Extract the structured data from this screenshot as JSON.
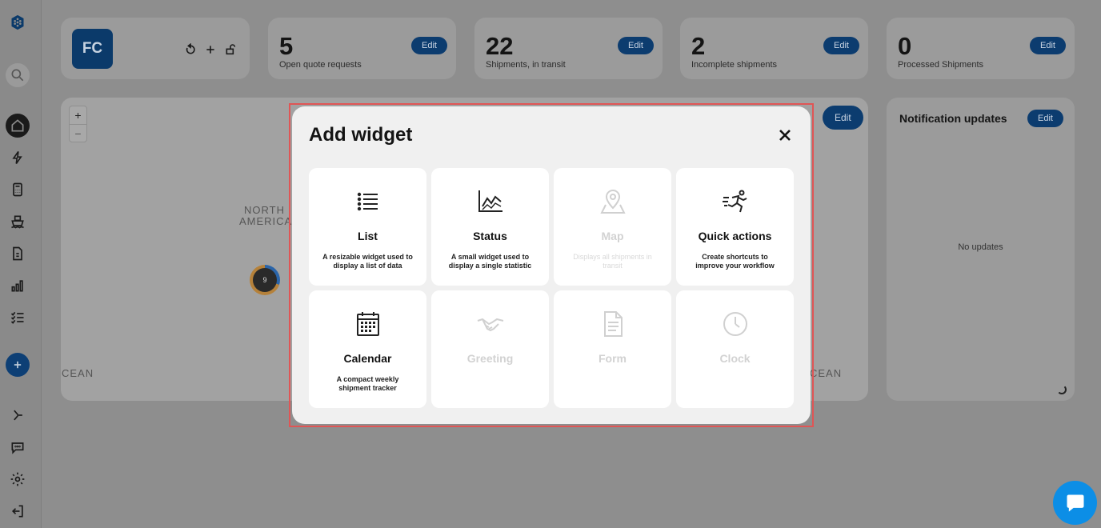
{
  "header": {
    "avatar_initials": "FC"
  },
  "stats": [
    {
      "value": "5",
      "label": "Open quote requests",
      "edit": "Edit"
    },
    {
      "value": "22",
      "label": "Shipments, in transit",
      "edit": "Edit"
    },
    {
      "value": "2",
      "label": "Incomplete shipments",
      "edit": "Edit"
    },
    {
      "value": "0",
      "label": "Processed Shipments",
      "edit": "Edit"
    }
  ],
  "map": {
    "edit": "Edit",
    "zoom_in": "+",
    "zoom_out": "−",
    "labels": [
      "NORTH",
      "AMERICA",
      "CEAN",
      "CEAN"
    ],
    "cluster_count": "9"
  },
  "notifications": {
    "title": "Notification updates",
    "edit": "Edit",
    "empty": "No updates"
  },
  "modal": {
    "title": "Add widget",
    "close_icon": "close-icon",
    "widgets": [
      {
        "title": "List",
        "desc": "A resizable widget used to display a list of data",
        "icon": "list-icon",
        "enabled": true
      },
      {
        "title": "Status",
        "desc": "A small widget used to display a single statistic",
        "icon": "chart-icon",
        "enabled": true
      },
      {
        "title": "Map",
        "desc": "Displays all shipments in transit",
        "icon": "map-pin-icon",
        "enabled": false
      },
      {
        "title": "Quick actions",
        "desc": "Create shortcuts to improve your workflow",
        "icon": "running-icon",
        "enabled": true
      },
      {
        "title": "Calendar",
        "desc": "A compact weekly shipment tracker",
        "icon": "calendar-icon",
        "enabled": true
      },
      {
        "title": "Greeting",
        "desc": "",
        "icon": "handshake-icon",
        "enabled": false
      },
      {
        "title": "Form",
        "desc": "",
        "icon": "document-icon",
        "enabled": false
      },
      {
        "title": "Clock",
        "desc": "",
        "icon": "clock-icon",
        "enabled": false
      }
    ]
  },
  "colors": {
    "primary": "#0c3c6f",
    "chat": "#0c8ee6",
    "highlight": "#e05555"
  }
}
